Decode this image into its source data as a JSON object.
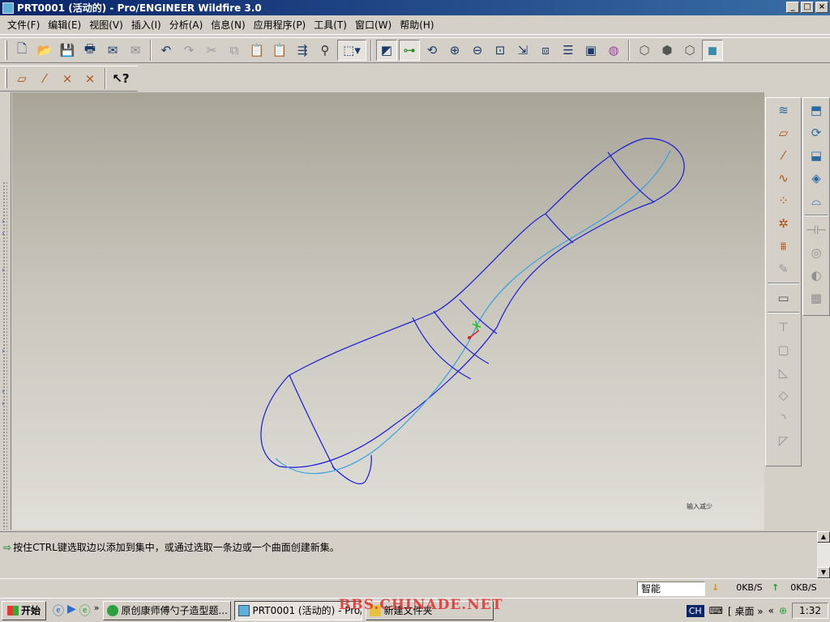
{
  "window": {
    "title": "PRT0001 (活动的) - Pro/ENGINEER Wildfire 3.0",
    "controls": {
      "minimize": "_",
      "maximize": "□",
      "close": "×"
    }
  },
  "menu": [
    "文件(F)",
    "编辑(E)",
    "视图(V)",
    "插入(I)",
    "分析(A)",
    "信息(N)",
    "应用程序(P)",
    "工具(T)",
    "窗口(W)",
    "帮助(H)"
  ],
  "toolbar_main": {
    "file_icons": [
      "new-file-icon",
      "open-file-icon",
      "save-icon",
      "print-icon",
      "email-icon",
      "email-link-icon"
    ],
    "edit_icons": [
      "undo-icon",
      "redo-icon",
      "cut-icon",
      "copy-icon",
      "paste-icon",
      "paste-special-icon",
      "regenerate-icon",
      "find-icon",
      "select-box-icon"
    ],
    "view_icons": [
      "datum-display-icon",
      "spin-center-icon",
      "orient-icon",
      "zoom-in-icon",
      "zoom-out-icon",
      "refit-icon",
      "reorient-icon",
      "saved-views-icon",
      "layers-icon",
      "view-manager-icon",
      "appearance-icon"
    ],
    "display_icons": [
      "wireframe-icon",
      "hidden-line-icon",
      "no-hidden-icon",
      "shading-icon"
    ]
  },
  "toolbar_datum": {
    "icons": [
      "datum-plane-display-icon",
      "datum-axis-display-icon",
      "datum-point-display-icon",
      "csys-display-icon"
    ],
    "help_icon": "context-help-icon"
  },
  "right_toolbar": {
    "datum_icons": [
      "sketched-curve-icon",
      "datum-plane-icon",
      "datum-axis-icon",
      "datum-curve-icon",
      "datum-point-icon",
      "datum-csys-icon",
      "analysis-feature-icon",
      "sketch-tool-icon"
    ],
    "annotation_icon": "annotation-icon",
    "feature_icons": [
      "hole-icon",
      "shell-icon",
      "rib-icon",
      "draft-icon",
      "round-icon",
      "chamfer-icon"
    ],
    "shape_icons": [
      "extrude-icon",
      "revolve-icon",
      "variable-sweep-icon",
      "boundary-blend-icon",
      "style-icon",
      "mirror-icon",
      "merge-icon",
      "trim-icon",
      "pattern-icon"
    ]
  },
  "viewport": {
    "corner_text": "输入减少"
  },
  "message": {
    "text": "按住CTRL键选取边以添加到集中，或通过选取一条边或一个曲面创建新集。"
  },
  "status": {
    "filter_value": "智能",
    "download": "0KB/S",
    "upload": "0KB/S"
  },
  "taskbar": {
    "start_label": "开始",
    "tasks": [
      "原创康师傅勺子造型题...",
      "PRT0001 (活动的) - Pro/...",
      "新建文件夹"
    ],
    "tray_ime": "CH",
    "tray_desktop": "桌面",
    "clock": "1:32"
  },
  "watermark": "BBS.CHINADE.NET",
  "colors": {
    "curve_blue": "#1a1ad8",
    "curve_cyan": "#3aa0e0",
    "title_bar": "#0a246a"
  }
}
